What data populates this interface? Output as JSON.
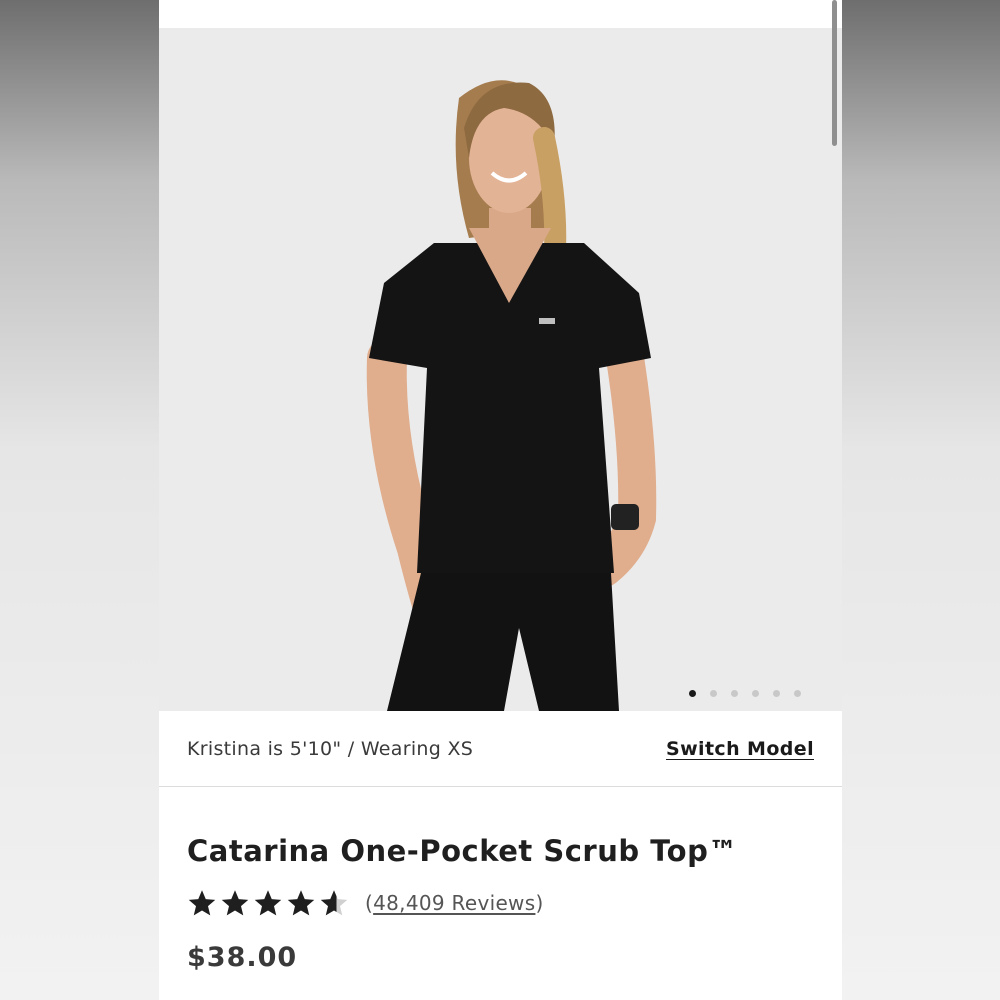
{
  "hero": {
    "image_alt": "Model wearing black Catarina One-Pocket Scrub Top",
    "carousel_total": 6,
    "carousel_active": 1
  },
  "model": {
    "info": "Kristina is 5'10\" / Wearing XS",
    "switch_label": "Switch Model"
  },
  "product": {
    "title": "Catarina One-Pocket Scrub Top™",
    "rating": 4.5,
    "reviews_open": "(",
    "reviews_label": "48,409 Reviews",
    "reviews_close": ")",
    "price": "$38.00"
  },
  "colors": {
    "scrub": "#141414",
    "hero_bg": "#ebebeb",
    "star": "#1f1f1f"
  },
  "icons": [
    "star-icon",
    "half-star-icon"
  ]
}
